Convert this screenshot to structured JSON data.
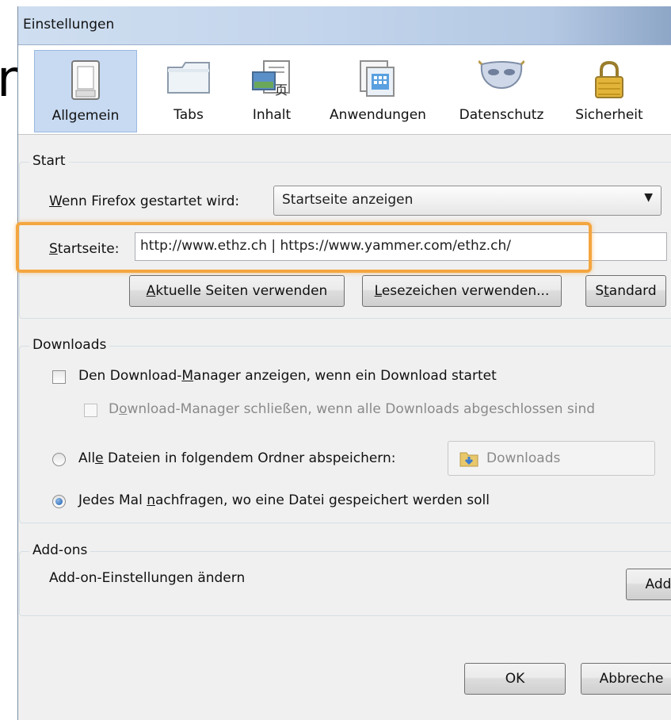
{
  "background": {
    "glyph": "n"
  },
  "window": {
    "title": "Einstellungen"
  },
  "toolbar": {
    "tabs": [
      {
        "label": "Allgemein",
        "icon": "switch-icon",
        "selected": true
      },
      {
        "label": "Tabs",
        "icon": "tabs-icon",
        "selected": false
      },
      {
        "label": "Inhalt",
        "icon": "content-icon",
        "selected": false
      },
      {
        "label": "Anwendungen",
        "icon": "applications-icon",
        "selected": false
      },
      {
        "label": "Datenschutz",
        "icon": "mask-icon",
        "selected": false
      },
      {
        "label": "Sicherheit",
        "icon": "lock-icon",
        "selected": false
      }
    ]
  },
  "start": {
    "title": "Start",
    "when_label_pre": "",
    "when_label_accel": "W",
    "when_label_post": "enn Firefox gestartet wird:",
    "when_value": "Startseite anzeigen",
    "homepage_label_accel": "S",
    "homepage_label_post": "tartseite:",
    "homepage_value": "http://www.ethz.ch | https://www.yammer.com/ethz.ch/",
    "btn_current_accel": "A",
    "btn_current_post": "ktuelle Seiten verwenden",
    "btn_bookmark_accel": "L",
    "btn_bookmark_post": "esezeichen verwenden...",
    "btn_default_pre": "S",
    "btn_default_accel": "t",
    "btn_default_post": "andard"
  },
  "downloads": {
    "title": "Downloads",
    "show_manager_pre": "Den Download-",
    "show_manager_accel": "M",
    "show_manager_post": "anager anzeigen, wenn ein Download startet",
    "close_manager_pre": "D",
    "close_manager_accel": "o",
    "close_manager_post": "wnload-Manager schließen, wenn alle Downloads abgeschlossen sind",
    "save_all_pre": "All",
    "save_all_accel": "e",
    "save_all_post": " Dateien in folgendem Ordner abspeichern:",
    "folder": "Downloads",
    "ask_pre": "Jedes Mal ",
    "ask_accel": "n",
    "ask_post": "achfragen, wo eine Datei gespeichert werden soll"
  },
  "addons": {
    "title": "Add-ons",
    "text": "Add-on-Einstellungen ändern",
    "button": "Add"
  },
  "footer": {
    "ok": "OK",
    "cancel": "Abbreche"
  },
  "colors": {
    "highlight": "#f4a640",
    "selected_tab": "#c7daf2"
  }
}
